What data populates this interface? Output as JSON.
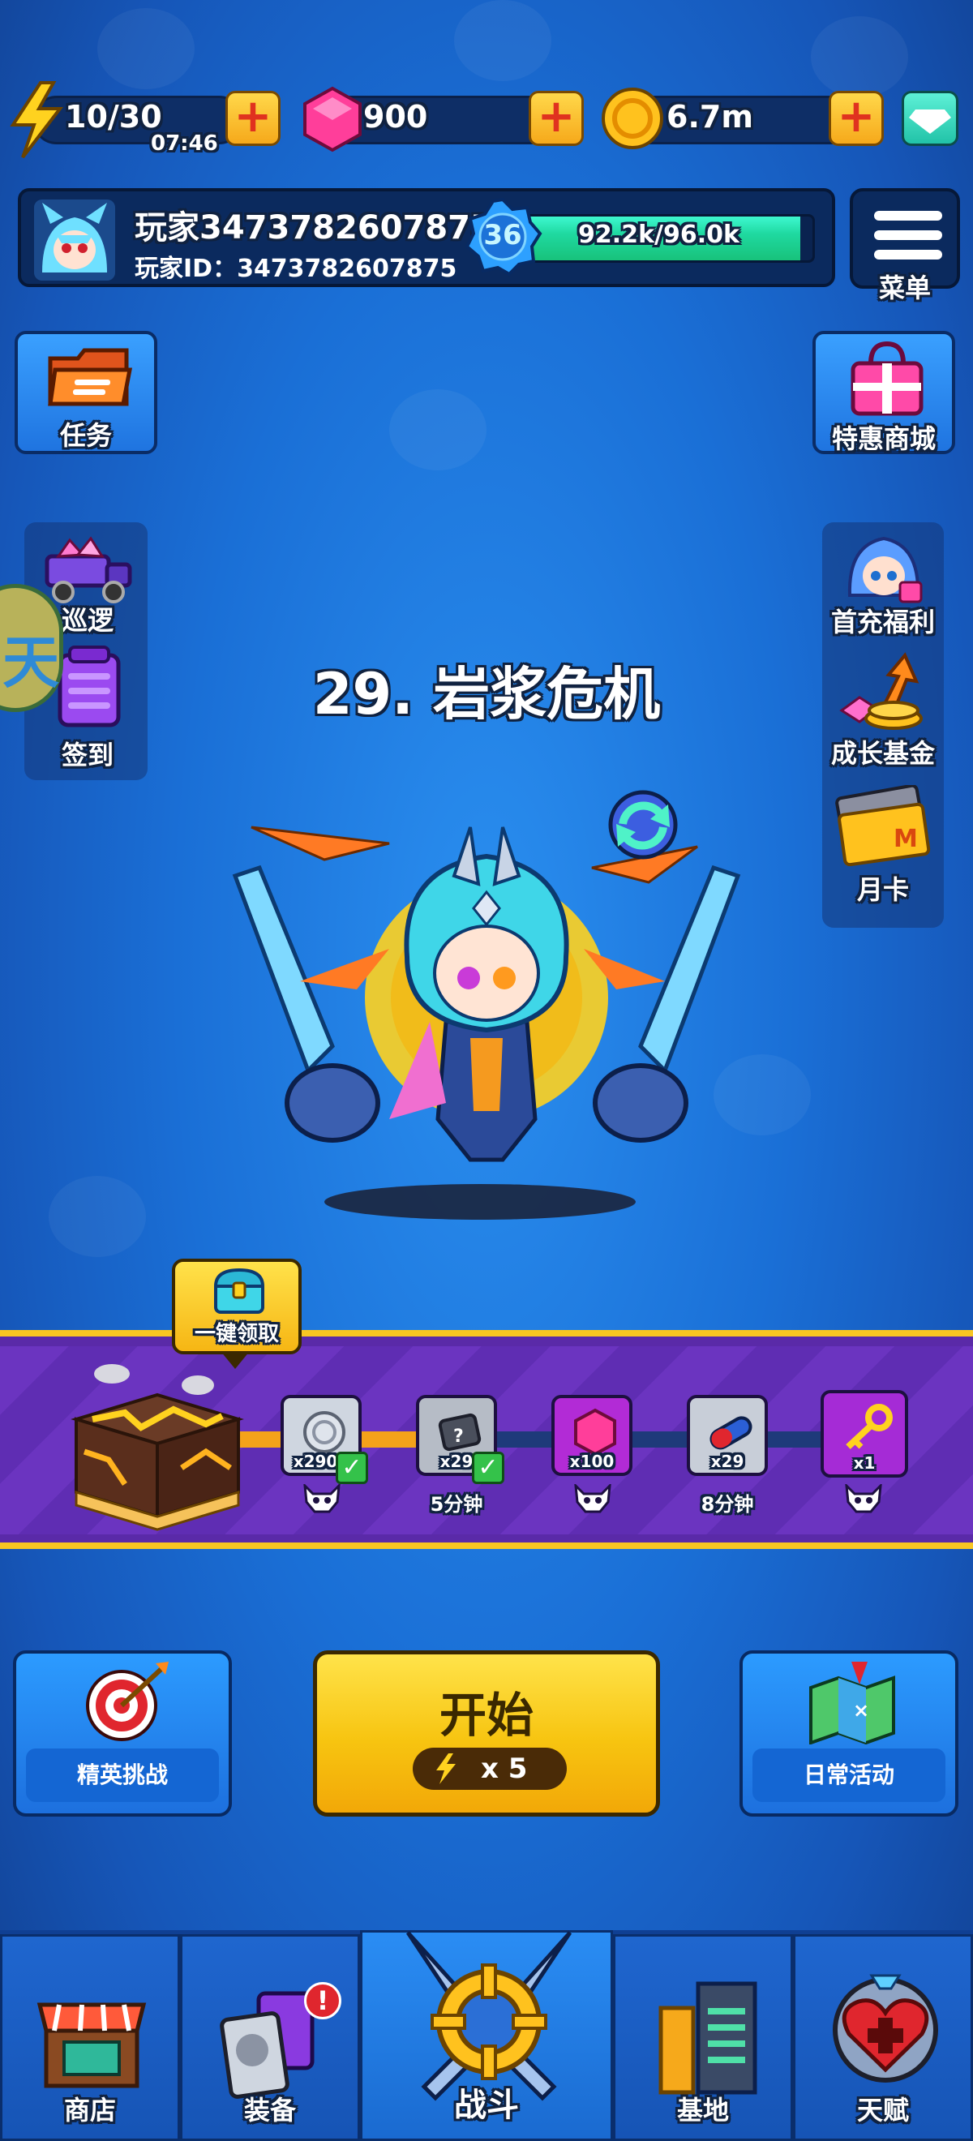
{
  "resources": {
    "energy": "10/30",
    "energy_timer": "07:46",
    "gems": "900",
    "gold": "6.7m"
  },
  "profile": {
    "name": "玩家3473782607875",
    "id_line": "玩家ID：3473782607875",
    "level": "36",
    "xp_text": "92.2k/96.0k",
    "xp_progress": 0.96
  },
  "menu_label": "菜单",
  "left_buttons": {
    "tasks": "任务",
    "patrol": "巡逻",
    "signin": "签到"
  },
  "right_buttons": {
    "shop_special": "特惠商城",
    "first_recharge": "首充福利",
    "growth_fund": "成长基金",
    "monthly_card": "月卡"
  },
  "stage_title": "29. 岩浆危机",
  "claim_all_label": "一键领取",
  "rewards": [
    {
      "icon": "silver-coin-icon",
      "qty": "x2900",
      "claimed": true,
      "color": "#cfd6e0"
    },
    {
      "icon": "mystery-ticket-icon",
      "qty": "x29",
      "claimed": true,
      "color": "#b6bcc6"
    },
    {
      "icon": "gem-icon",
      "qty": "x100",
      "claimed": false,
      "color": "#b22bd6"
    },
    {
      "icon": "pill-icon",
      "qty": "x29",
      "claimed": false,
      "color": "#c8ced8"
    },
    {
      "icon": "key-icon",
      "qty": "x1",
      "claimed": false,
      "color": "#a52bd6"
    }
  ],
  "milestones": [
    "5分钟",
    "8分钟"
  ],
  "actions": {
    "elite": "精英挑战",
    "start": "开始",
    "start_cost": "x 5",
    "daily": "日常活动"
  },
  "nav": {
    "shop": "商店",
    "equip": "装备",
    "battle": "战斗",
    "base": "基地",
    "talent": "天赋"
  },
  "colors": {
    "accent_yellow": "#f8c622",
    "strip_purple": "#5a2aa8",
    "bg_blue": "#1a6fd6",
    "xp_green": "#1fd9a0"
  }
}
